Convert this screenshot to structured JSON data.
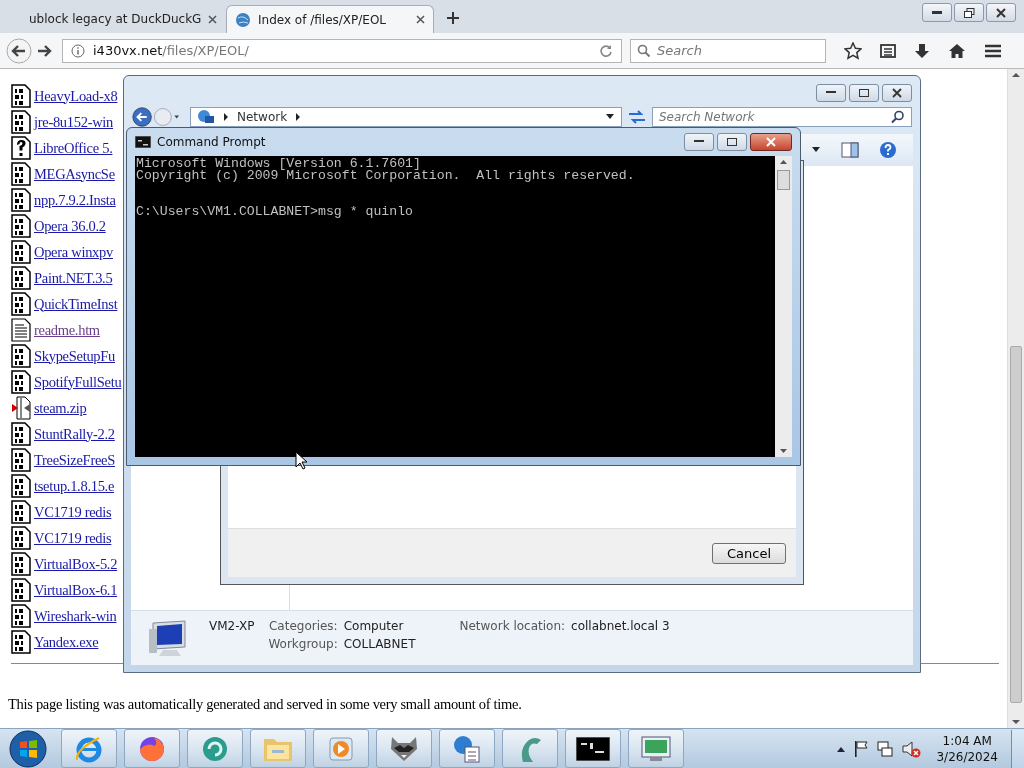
{
  "browser": {
    "tabs": [
      {
        "title": "ublock legacy at DuckDuckG",
        "selected": false
      },
      {
        "title": "Index of /files/XP/EOL",
        "selected": true
      }
    ],
    "address": {
      "host": "i430vx.net",
      "path": "/files/XP/EOL/"
    },
    "search": {
      "placeholder": "Search"
    }
  },
  "listing": {
    "files": [
      {
        "name": "HeavyLoad-x8",
        "kind": "binary",
        "visited": false
      },
      {
        "name": "jre-8u152-win",
        "kind": "binary",
        "visited": false
      },
      {
        "name": "LibreOffice 5.",
        "kind": "unknown",
        "visited": false
      },
      {
        "name": "MEGAsyncSe",
        "kind": "binary",
        "visited": false
      },
      {
        "name": "npp.7.9.2.Insta",
        "kind": "binary",
        "visited": false
      },
      {
        "name": "Opera 36.0.2",
        "kind": "binary",
        "visited": false
      },
      {
        "name": "Opera winxpv",
        "kind": "binary",
        "visited": false
      },
      {
        "name": "Paint.NET.3.5",
        "kind": "binary",
        "visited": false
      },
      {
        "name": "QuickTimeInst",
        "kind": "binary",
        "visited": false
      },
      {
        "name": "readme.htm",
        "kind": "text",
        "visited": true
      },
      {
        "name": "SkypeSetupFu",
        "kind": "binary",
        "visited": false
      },
      {
        "name": "SpotifyFullSetu",
        "kind": "binary",
        "visited": false
      },
      {
        "name": "steam.zip",
        "kind": "archive",
        "visited": false
      },
      {
        "name": "StuntRally-2.2",
        "kind": "binary",
        "visited": false
      },
      {
        "name": "TreeSizeFreeS",
        "kind": "binary",
        "visited": false
      },
      {
        "name": "tsetup.1.8.15.e",
        "kind": "binary",
        "visited": false
      },
      {
        "name": "VC1719 redis",
        "kind": "binary",
        "visited": false
      },
      {
        "name": "VC1719 redis",
        "kind": "binary",
        "visited": false
      },
      {
        "name": "VirtualBox-5.2",
        "kind": "binary",
        "visited": false
      },
      {
        "name": "VirtualBox-6.1",
        "kind": "binary",
        "visited": false
      },
      {
        "name": "Wireshark-win",
        "kind": "binary",
        "visited": false
      },
      {
        "name": "Yandex.exe",
        "kind": "binary",
        "visited": false
      }
    ],
    "footer": "This page listing was automatically generated and served in some very small amount of time."
  },
  "explorer": {
    "breadcrumb": "Network",
    "search": {
      "placeholder": "Search Network"
    },
    "details": {
      "name": "VM2-XP",
      "fields": [
        {
          "label": "Categories:",
          "value": "Computer"
        },
        {
          "label": "Workgroup:",
          "value": "COLLABNET"
        },
        {
          "label": "Network location:",
          "value": "collabnet.local 3"
        }
      ]
    }
  },
  "dialog": {
    "buttons": [
      "Cancel"
    ]
  },
  "console": {
    "title": "Command Prompt",
    "lines": [
      "Microsoft Windows [Version 6.1.7601]",
      "Copyright (c) 2009 Microsoft Corporation.  All rights reserved."
    ],
    "prompt": "C:\\Users\\VM1.COLLABNET>msg * quinlo"
  },
  "taskbar": {
    "apps": [
      {
        "kind": "ie"
      },
      {
        "kind": "firefox"
      },
      {
        "kind": "sync"
      },
      {
        "kind": "folder"
      },
      {
        "kind": "media"
      },
      {
        "kind": "raccoon"
      },
      {
        "kind": "network"
      },
      {
        "kind": "dragon"
      },
      {
        "kind": "console"
      },
      {
        "kind": "monitor"
      }
    ],
    "time": "1:04 AM",
    "date": "3/26/2024"
  }
}
